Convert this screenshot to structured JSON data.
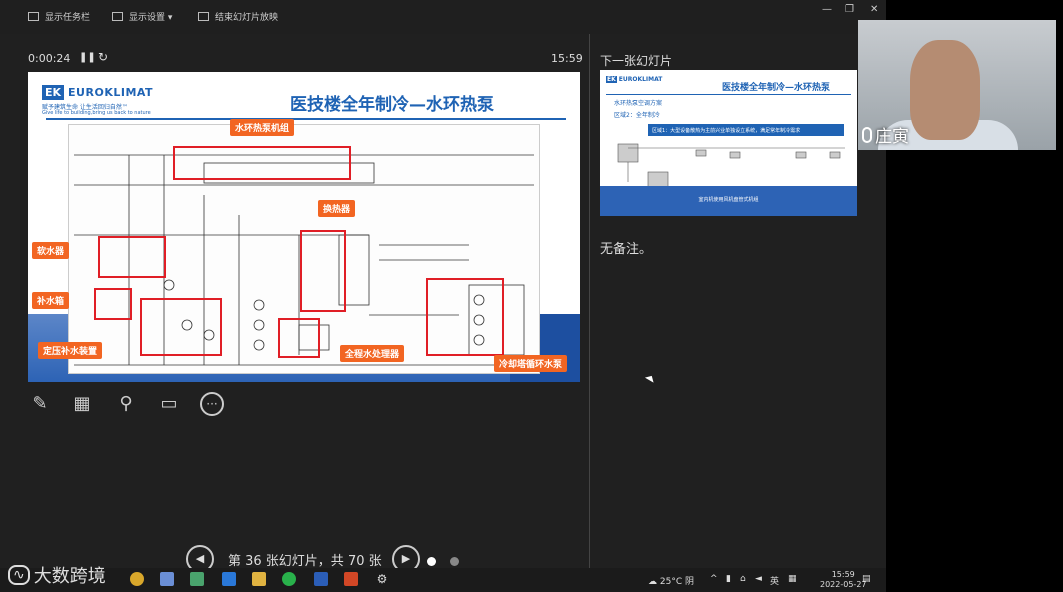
{
  "toolbar": {
    "show_taskbar": "显示任务栏",
    "display_settings": "显示设置 ▾",
    "end_slideshow": "结束幻灯片放映"
  },
  "presenter": {
    "elapsed_time": "0:00:24",
    "clock": "15:59",
    "slide_counter": "第 36 张幻灯片，共 70 张",
    "current_slide_number": 36,
    "total_slides": 70
  },
  "current_slide": {
    "logo_mark": "EK",
    "logo_name": "EUROKLIMAT",
    "logo_tagline": "赋予建筑生命  让生活回归自然™",
    "logo_tagline_en": "Give life to building,bring us back to nature",
    "title": "医技楼全年制冷—水环热泵",
    "callouts": {
      "heat_pump_unit": "水环热泵机组",
      "heat_exchanger": "换热器",
      "softener": "软水器",
      "makeup_tank": "补水箱",
      "pressure_unit": "定压补水装置",
      "water_treatment": "全程水处理器",
      "cooling_tower_pump": "冷却塔循环水泵"
    }
  },
  "next_slide": {
    "label": "下一张幻灯片",
    "title": "医技楼全年制冷—水环热泵",
    "sub1": "水环热泵空调方案",
    "sub2": "区域2：全年制冷",
    "band": "区域1：大型设备散热为主前兴业单独设立系统，满足常年制冷需求",
    "bottom": "室内机使用风机盘管式机组"
  },
  "notes": "无备注。",
  "webcam": {
    "participant_name": "庄寅"
  },
  "taskbar": {
    "weather": "25°C 阴",
    "ime": "英",
    "time": "15:59",
    "date": "2022-05-27"
  },
  "watermark": "大数跨境",
  "colors": {
    "accent_blue": "#1f63b4",
    "callout_orange": "#f26522",
    "highlight_red": "#e01e26"
  }
}
